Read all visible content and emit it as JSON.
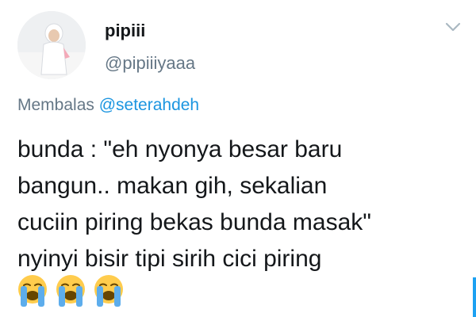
{
  "tweet": {
    "display_name": "pipiii",
    "handle": "@pipiiiyaaa",
    "reply_prefix": "Membalas ",
    "reply_mention": "@seterahdeh",
    "body": "bunda : \"eh nyonya besar baru\nbangun.. makan gih, sekalian\ncuciin piring bekas bunda masak\"\nnyinyi bisir tipi sirih cici piring",
    "emojis": [
      "loudly-crying-face-emoji",
      "loudly-crying-face-emoji",
      "loudly-crying-face-emoji"
    ]
  },
  "icons": {
    "menu": "chevron-down-icon",
    "avatar": "avatar"
  },
  "colors": {
    "name": "#14171a",
    "secondary": "#657786",
    "mention": "#1b95e0",
    "emoji_face": "#ffcc4d",
    "tears": "#5dadec"
  }
}
